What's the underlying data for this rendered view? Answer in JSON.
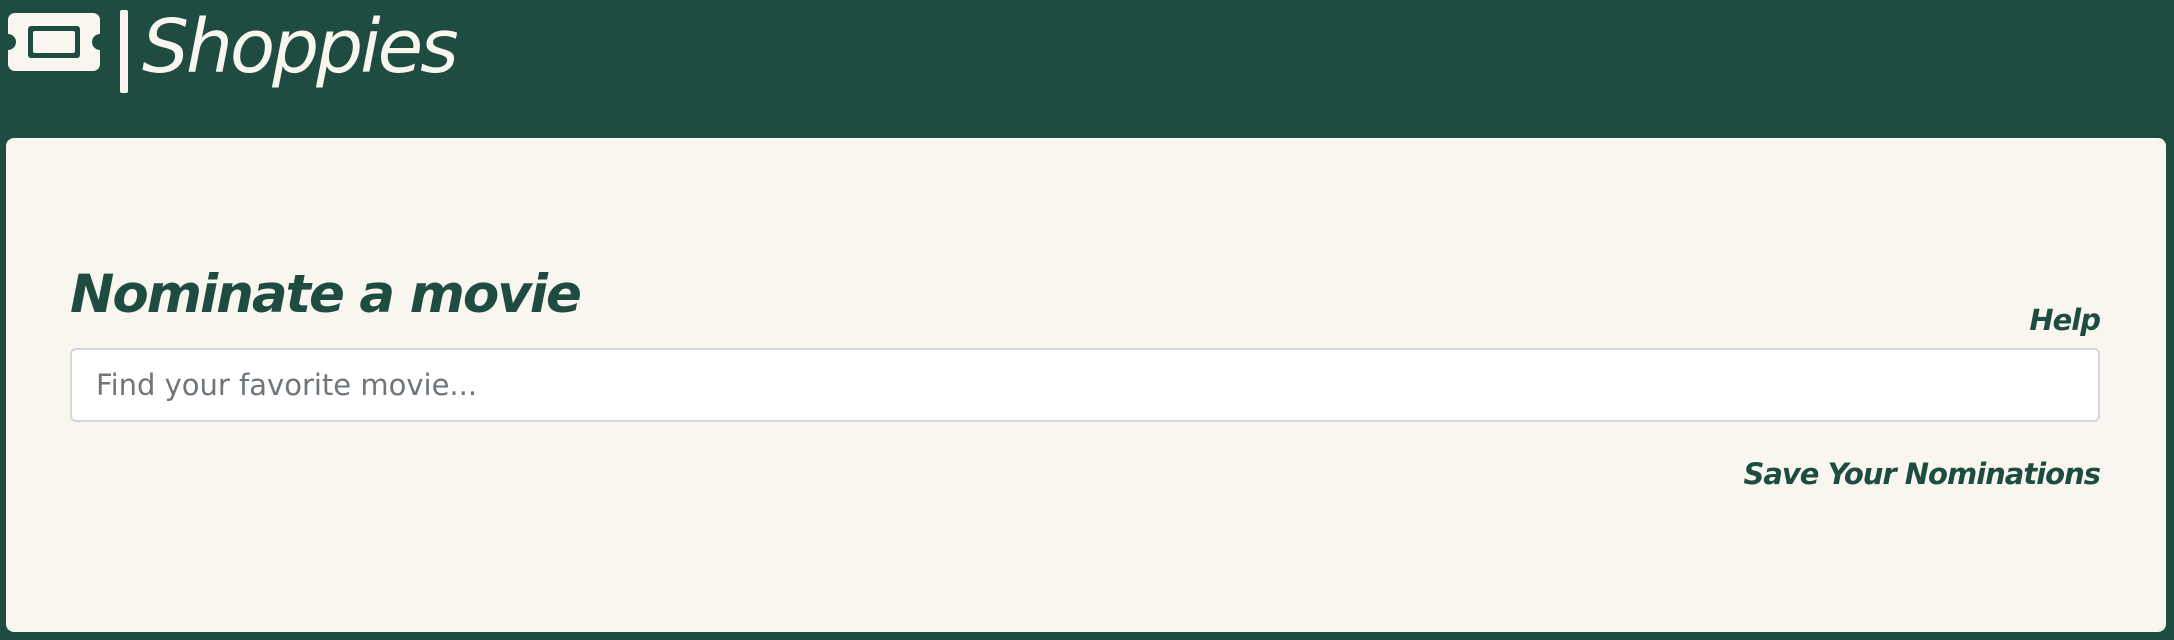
{
  "header": {
    "app_name": "Shoppies",
    "logo_icon": "ticket-icon"
  },
  "main": {
    "title": "Nominate a movie",
    "help_label": "Help",
    "search": {
      "placeholder": "Find your favorite movie...",
      "value": ""
    },
    "save_label": "Save Your Nominations"
  },
  "colors": {
    "background": "#1f4c40",
    "card": "#f8f6ef",
    "text_accent": "#1f4c40",
    "input_border": "#d3d6da"
  }
}
